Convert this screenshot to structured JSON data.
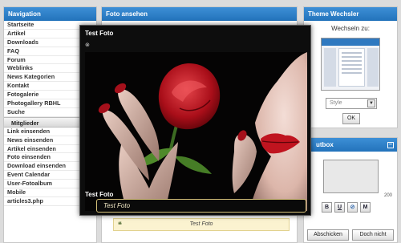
{
  "nav": {
    "title": "Navigation",
    "items": [
      "Startseite",
      "Artikel",
      "Downloads",
      "FAQ",
      "Forum",
      "Weblinks",
      "News Kategorien",
      "Kontakt",
      "Fotogalerie",
      "Photogallery RBHL",
      "Suche"
    ],
    "section": "Mitglieder",
    "member_items": [
      "Link einsenden",
      "News einsenden",
      "Artikel einsenden",
      "Foto einsenden",
      "Download einsenden",
      "Event Calendar",
      "User-Fotoalbum",
      "Mobile",
      "articles3.php"
    ]
  },
  "center": {
    "title": "Foto ansehen",
    "quote_text": "Test Foto"
  },
  "theme": {
    "title": "Theme Wechsler",
    "switch_label": "Wechseln zu:",
    "style_placeholder": "Style",
    "ok_label": "OK"
  },
  "shoutbox": {
    "title": "utbox",
    "counter": "200",
    "format_buttons": [
      "B",
      "U",
      "⊘",
      "M"
    ],
    "submit_label": "Abschicken",
    "cancel_label": "Doch nicht"
  },
  "lightbox": {
    "title": "Test Foto",
    "close_symbol": "⊗",
    "caption_label": "Test Foto",
    "caption_value": "Test Foto"
  }
}
